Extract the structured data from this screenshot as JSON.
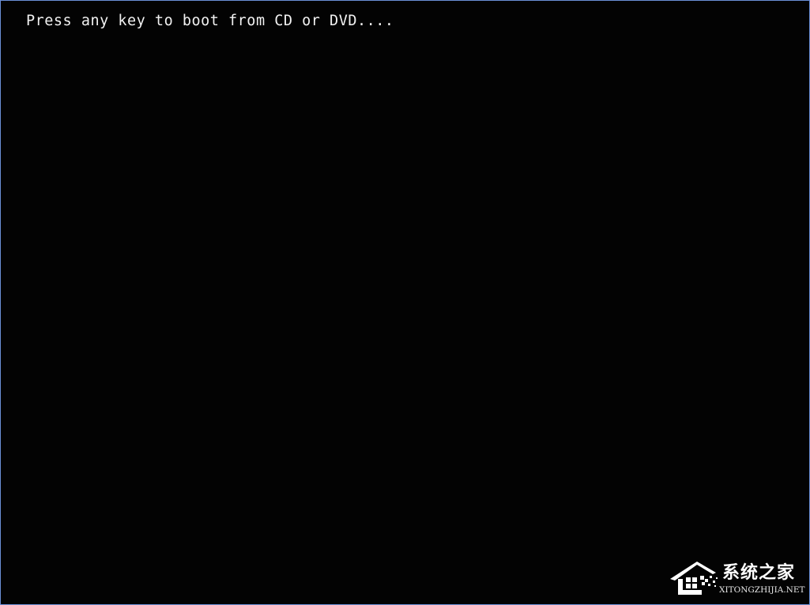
{
  "screen": {
    "background_color": "#000000",
    "border_color": "#6b8fd6",
    "text_color": "#f2f2f2"
  },
  "boot": {
    "message": "Press any key to boot from CD or DVD...."
  },
  "watermark": {
    "icon": "house-logo-icon",
    "title": "系统之家",
    "url": "XITONGZHIJIA.NET"
  }
}
